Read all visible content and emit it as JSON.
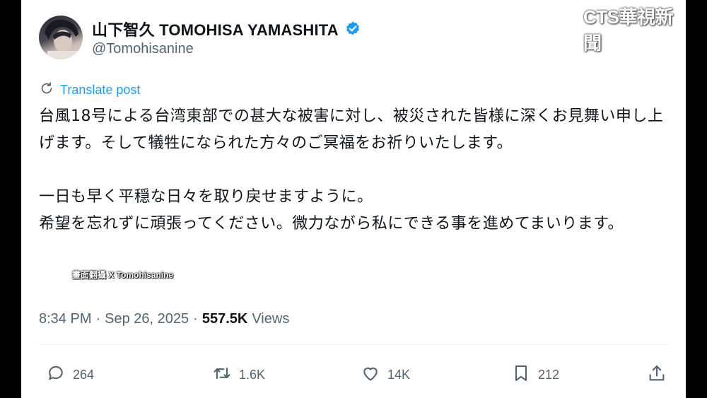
{
  "author": {
    "display_name": "山下智久 TOMOHISA YAMASHITA",
    "handle": "@Tomohisanine",
    "verified": true
  },
  "watermark": "CTS華視新聞",
  "translate_label": "Translate post",
  "post": {
    "paragraph1": "台風18号による台湾東部での甚大な被害に対し、被災された皆様に深くお見舞い申し上げます。そして犠牲になられた方々のご冥福をお祈りいたします。",
    "paragraph2_line1": "一日も早く平穏な日々を取り戻せますように。",
    "paragraph2_line2": "希望を忘れずに頑張ってください。微力ながら私にできる事を進めてまいります。"
  },
  "caption": "畫面翻攝 X Tomohisanine",
  "meta": {
    "time": "8:34 PM",
    "date": "Sep 26, 2025",
    "separator": "·",
    "views_count": "557.5K",
    "views_label": "Views"
  },
  "actions": {
    "replies": "264",
    "reposts": "1.6K",
    "likes": "14K",
    "bookmarks": "212"
  },
  "colors": {
    "accent": "#1d9bf0",
    "text": "#0f1419",
    "secondary": "#536471"
  }
}
